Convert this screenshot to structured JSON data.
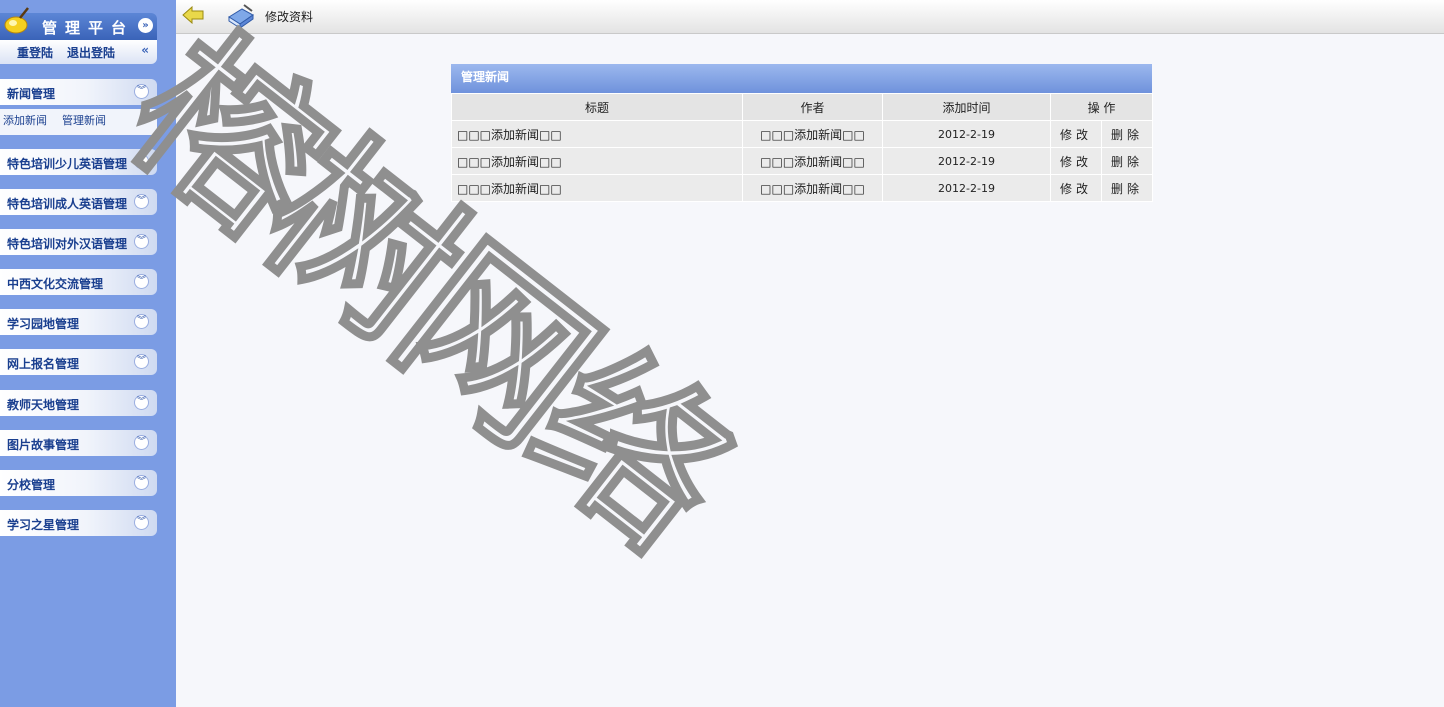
{
  "sidebar": {
    "brand_title": "管理平台",
    "relogin": "重登陆",
    "logout": "退出登陆",
    "back_glyph": "«",
    "collapse_glyph": "»",
    "menus": [
      {
        "label": "新闻管理"
      },
      {
        "label": "特色培训少儿英语管理"
      },
      {
        "label": "特色培训成人英语管理"
      },
      {
        "label": "特色培训对外汉语管理"
      },
      {
        "label": "中西文化交流管理"
      },
      {
        "label": "学习园地管理"
      },
      {
        "label": "网上报名管理"
      },
      {
        "label": "教师天地管理"
      },
      {
        "label": "图片故事管理"
      },
      {
        "label": "分校管理"
      },
      {
        "label": "学习之星管理"
      }
    ],
    "submenu": {
      "add": "添加新闻",
      "manage": "管理新闻"
    }
  },
  "topbar": {
    "title": "修改资料"
  },
  "panel": {
    "title": "管理新闻",
    "columns": [
      "标题",
      "作者",
      "添加时间",
      "操 作"
    ],
    "rows": [
      {
        "title": "□□□添加新闻□□",
        "author": "□□□添加新闻□□",
        "date": "2012-2-19",
        "edit": "修改",
        "delete": "删除"
      },
      {
        "title": "□□□添加新闻□□",
        "author": "□□□添加新闻□□",
        "date": "2012-2-19",
        "edit": "修改",
        "delete": "删除"
      },
      {
        "title": "□□□添加新闻□□",
        "author": "□□□添加新闻□□",
        "date": "2012-2-19",
        "edit": "修改",
        "delete": "删除"
      }
    ]
  },
  "watermark": "榕树网络",
  "colors": {
    "sidebar": "#7b9ce4",
    "panel_header": "#7f9fe2",
    "menu_text": "#1a3f8f"
  },
  "icons": [
    "logo-icon",
    "chevron-down-icon",
    "back-arrow-icon",
    "book-icon"
  ]
}
